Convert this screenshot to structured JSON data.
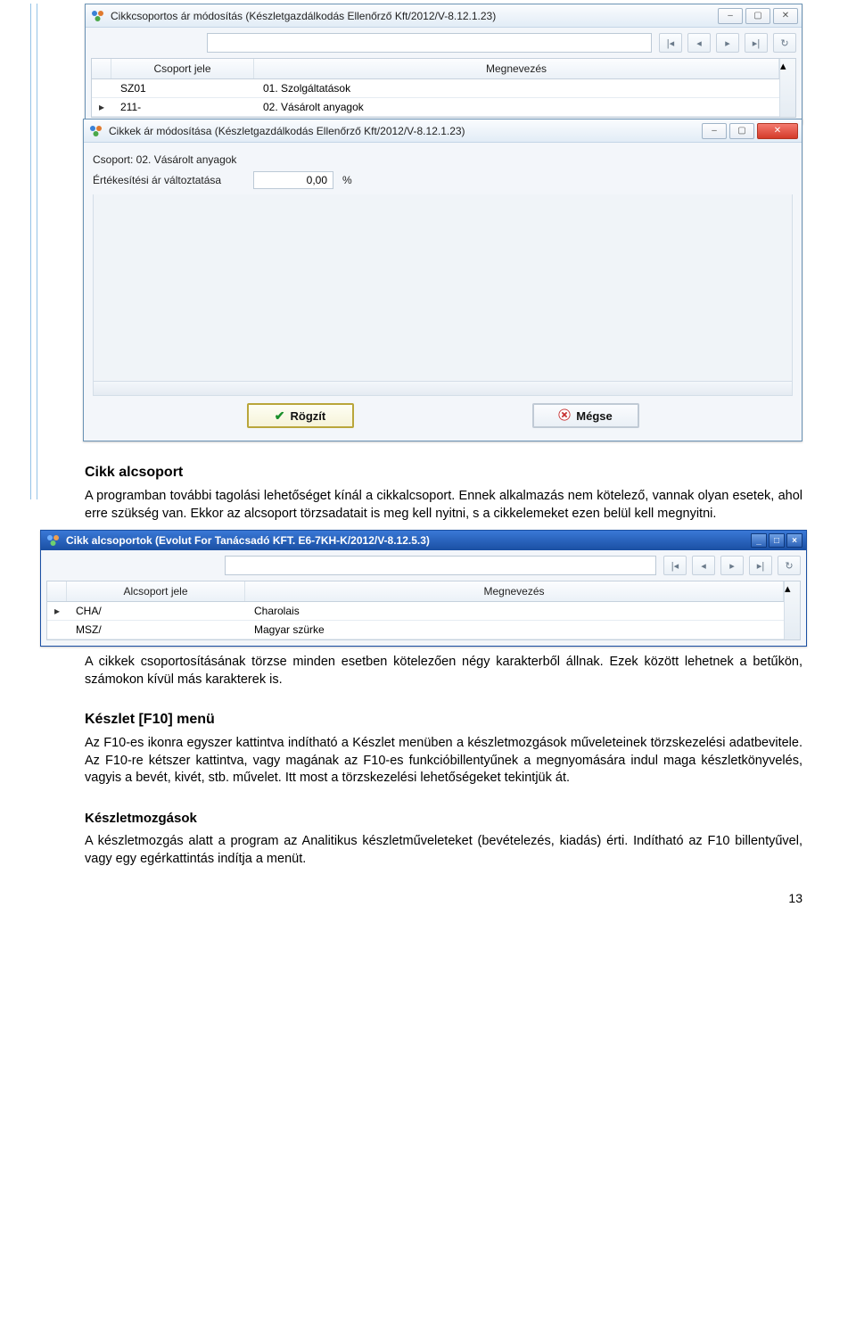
{
  "win1": {
    "title": "Cikkcsoportos ár módosítás (Készletgazdálkodás Ellenőrző Kft/2012/V-8.12.1.23)",
    "col_code": "Csoport jele",
    "col_name": "Megnevezés",
    "rows": [
      {
        "sel": "",
        "code": "SZ01",
        "name": "01. Szolgáltatások"
      },
      {
        "sel": "▸",
        "code": "211-",
        "name": "02. Vásárolt anyagok"
      }
    ]
  },
  "win2": {
    "title": "Cikkek ár módosítása (Készletgazdálkodás Ellenőrző Kft/2012/V-8.12.1.23)",
    "group_label": "Csoport: 02. Vásárolt anyagok",
    "price_label": "Értékesítési ár változtatása",
    "price_value": "0,00",
    "pct": "%",
    "btn_save": "Rögzít",
    "btn_cancel": "Mégse"
  },
  "win3": {
    "title": "Cikk alcsoportok (Evolut For Tanácsadó KFT. E6-7KH-K/2012/V-8.12.5.3)",
    "col_code": "Alcsoport jele",
    "col_name": "Megnevezés",
    "rows": [
      {
        "sel": "▸",
        "code": "CHA/",
        "name": "Charolais"
      },
      {
        "sel": "",
        "code": "MSZ/",
        "name": "Magyar szürke"
      }
    ]
  },
  "doc": {
    "h_alcs": "Cikk alcsoport",
    "p_alcs": "A programban további tagolási lehetőséget kínál a cikkalcsoport. Ennek alkalmazás nem kötelező, vannak olyan esetek, ahol erre szükség van. Ekkor az alcsoport törzsadatait is meg kell nyitni, s a cikkelemeket ezen belül kell megnyitni.",
    "p_alcs2": "A cikkek csoportosításának törzse minden esetben kötelezően négy karakterből állnak. Ezek között lehetnek a betűkön, számokon kívül más karakterek is.",
    "h_f10": "Készlet [F10] menü",
    "p_f10": "Az F10-es ikonra egyszer kattintva indítható a Készlet menüben a készletmozgások műveleteinek törzskezelési adatbevitele. Az F10-re kétszer kattintva, vagy magának az F10-es funkcióbillentyűnek a megnyomására indul maga készletkönyvelés, vagyis a bevét, kivét, stb. művelet. Itt most a törzskezelési lehetőségeket tekintjük át.",
    "h_moz": "Készletmozgások",
    "p_moz": "A készletmozgás alatt a program az Analitikus készletműveleteket (bevételezés, kiadás) érti. Indítható az F10 billentyűvel, vagy egy egérkattintás indítja a menüt.",
    "pagenum": "13"
  }
}
